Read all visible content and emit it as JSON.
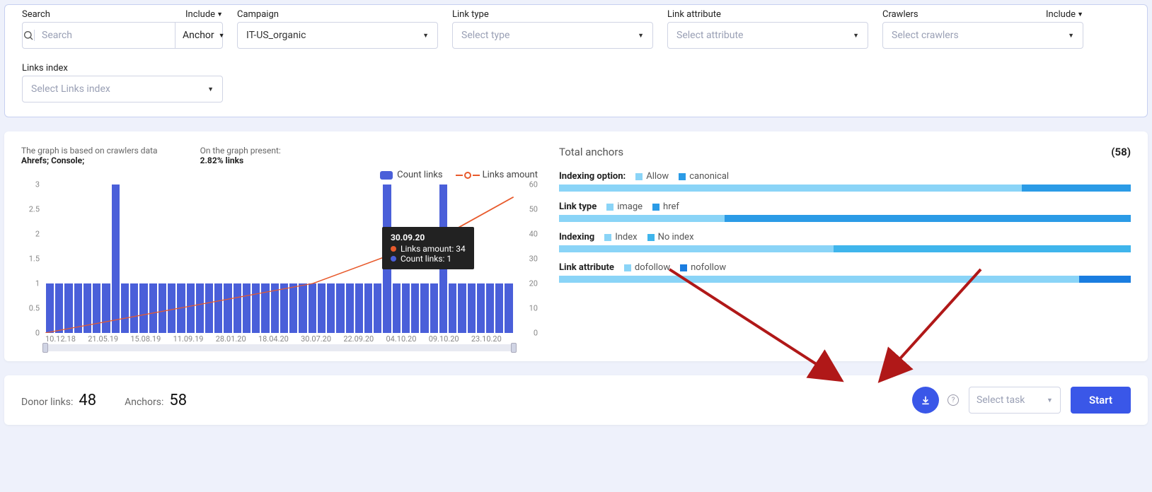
{
  "filters": {
    "search": {
      "label": "Search",
      "include": "Include",
      "placeholder": "Search",
      "anchor_drop": "Anchor"
    },
    "campaign": {
      "label": "Campaign",
      "value": "IT-US_organic"
    },
    "link_type": {
      "label": "Link type",
      "placeholder": "Select type"
    },
    "link_attribute": {
      "label": "Link attribute",
      "placeholder": "Select attribute"
    },
    "crawlers": {
      "label": "Crawlers",
      "include": "Include",
      "placeholder": "Select crawlers"
    },
    "links_index": {
      "label": "Links index",
      "placeholder": "Select Links index"
    }
  },
  "chart": {
    "meta1_label": "The graph is based on crawlers data",
    "meta1_value": "Ahrefs; Console;",
    "meta2_label": "On the graph present:",
    "meta2_value": "2.82% links",
    "legend_bars": "Count links",
    "legend_line": "Links amount",
    "y_left": [
      "3",
      "2.5",
      "2",
      "1.5",
      "1",
      "0.5",
      "0"
    ],
    "y_right": [
      "60",
      "50",
      "40",
      "30",
      "20",
      "10",
      "0"
    ],
    "x_ticks": [
      "10.12.18",
      "21.05.19",
      "15.08.19",
      "11.09.19",
      "28.01.20",
      "18.04.20",
      "30.07.20",
      "22.09.20",
      "04.10.20",
      "09.10.20",
      "23.10.20"
    ],
    "tooltip": {
      "date": "30.09.20",
      "row1": "Links amount: 34",
      "row2": "Count links: 1"
    }
  },
  "anchors": {
    "title": "Total anchors",
    "count": "(58)",
    "rows": [
      {
        "name": "Indexing option:",
        "l1": "Allow",
        "l2": "canonical",
        "p1": 81,
        "c1": "#8ad4f7",
        "c2": "#2b9be6"
      },
      {
        "name": "Link type",
        "l1": "image",
        "l2": "href",
        "p1": 29,
        "c1": "#8ad4f7",
        "c2": "#2b9be6"
      },
      {
        "name": "Indexing",
        "l1": "Index",
        "l2": "No index",
        "p1": 48,
        "c1": "#8ad4f7",
        "c2": "#3fb5ec"
      },
      {
        "name": "Link attribute",
        "l1": "dofollow",
        "l2": "nofollow",
        "p1": 91,
        "c1": "#8ad4f7",
        "c2": "#1a7de0"
      }
    ]
  },
  "bottom": {
    "donor_label": "Donor links:",
    "donor_value": "48",
    "anchors_label": "Anchors:",
    "anchors_value": "58",
    "task_placeholder": "Select task",
    "start": "Start"
  },
  "chart_data": {
    "type": "bar",
    "title": "",
    "xlabel": "",
    "ylabel_left": "Count links",
    "ylabel_right": "Links amount",
    "ylim_left": [
      0,
      3
    ],
    "ylim_right": [
      0,
      60
    ],
    "x_labels": [
      "10.12.18",
      "21.05.19",
      "15.08.19",
      "11.09.19",
      "28.01.20",
      "18.04.20",
      "30.07.20",
      "22.09.20",
      "04.10.20",
      "09.10.20",
      "23.10.20"
    ],
    "series": [
      {
        "name": "Count links",
        "type": "bar",
        "values": [
          1,
          1,
          1,
          1,
          1,
          1,
          1,
          3,
          1,
          1,
          1,
          1,
          1,
          1,
          1,
          1,
          1,
          1,
          1,
          1,
          1,
          1,
          1,
          1,
          1,
          1,
          1,
          1,
          1,
          1,
          1,
          1,
          1,
          1,
          1,
          1,
          3,
          1,
          1,
          1,
          1,
          1,
          3,
          1,
          1,
          1,
          1,
          1,
          1,
          1
        ]
      },
      {
        "name": "Links amount",
        "type": "line",
        "sample_points": [
          [
            0,
            0
          ],
          [
            7,
            5
          ],
          [
            14,
            10
          ],
          [
            21,
            15
          ],
          [
            28,
            20
          ],
          [
            35,
            30
          ],
          [
            42,
            40
          ],
          [
            49,
            55
          ]
        ]
      }
    ],
    "tooltip_sample": {
      "date": "30.09.20",
      "Links amount": 34,
      "Count links": 1
    }
  }
}
